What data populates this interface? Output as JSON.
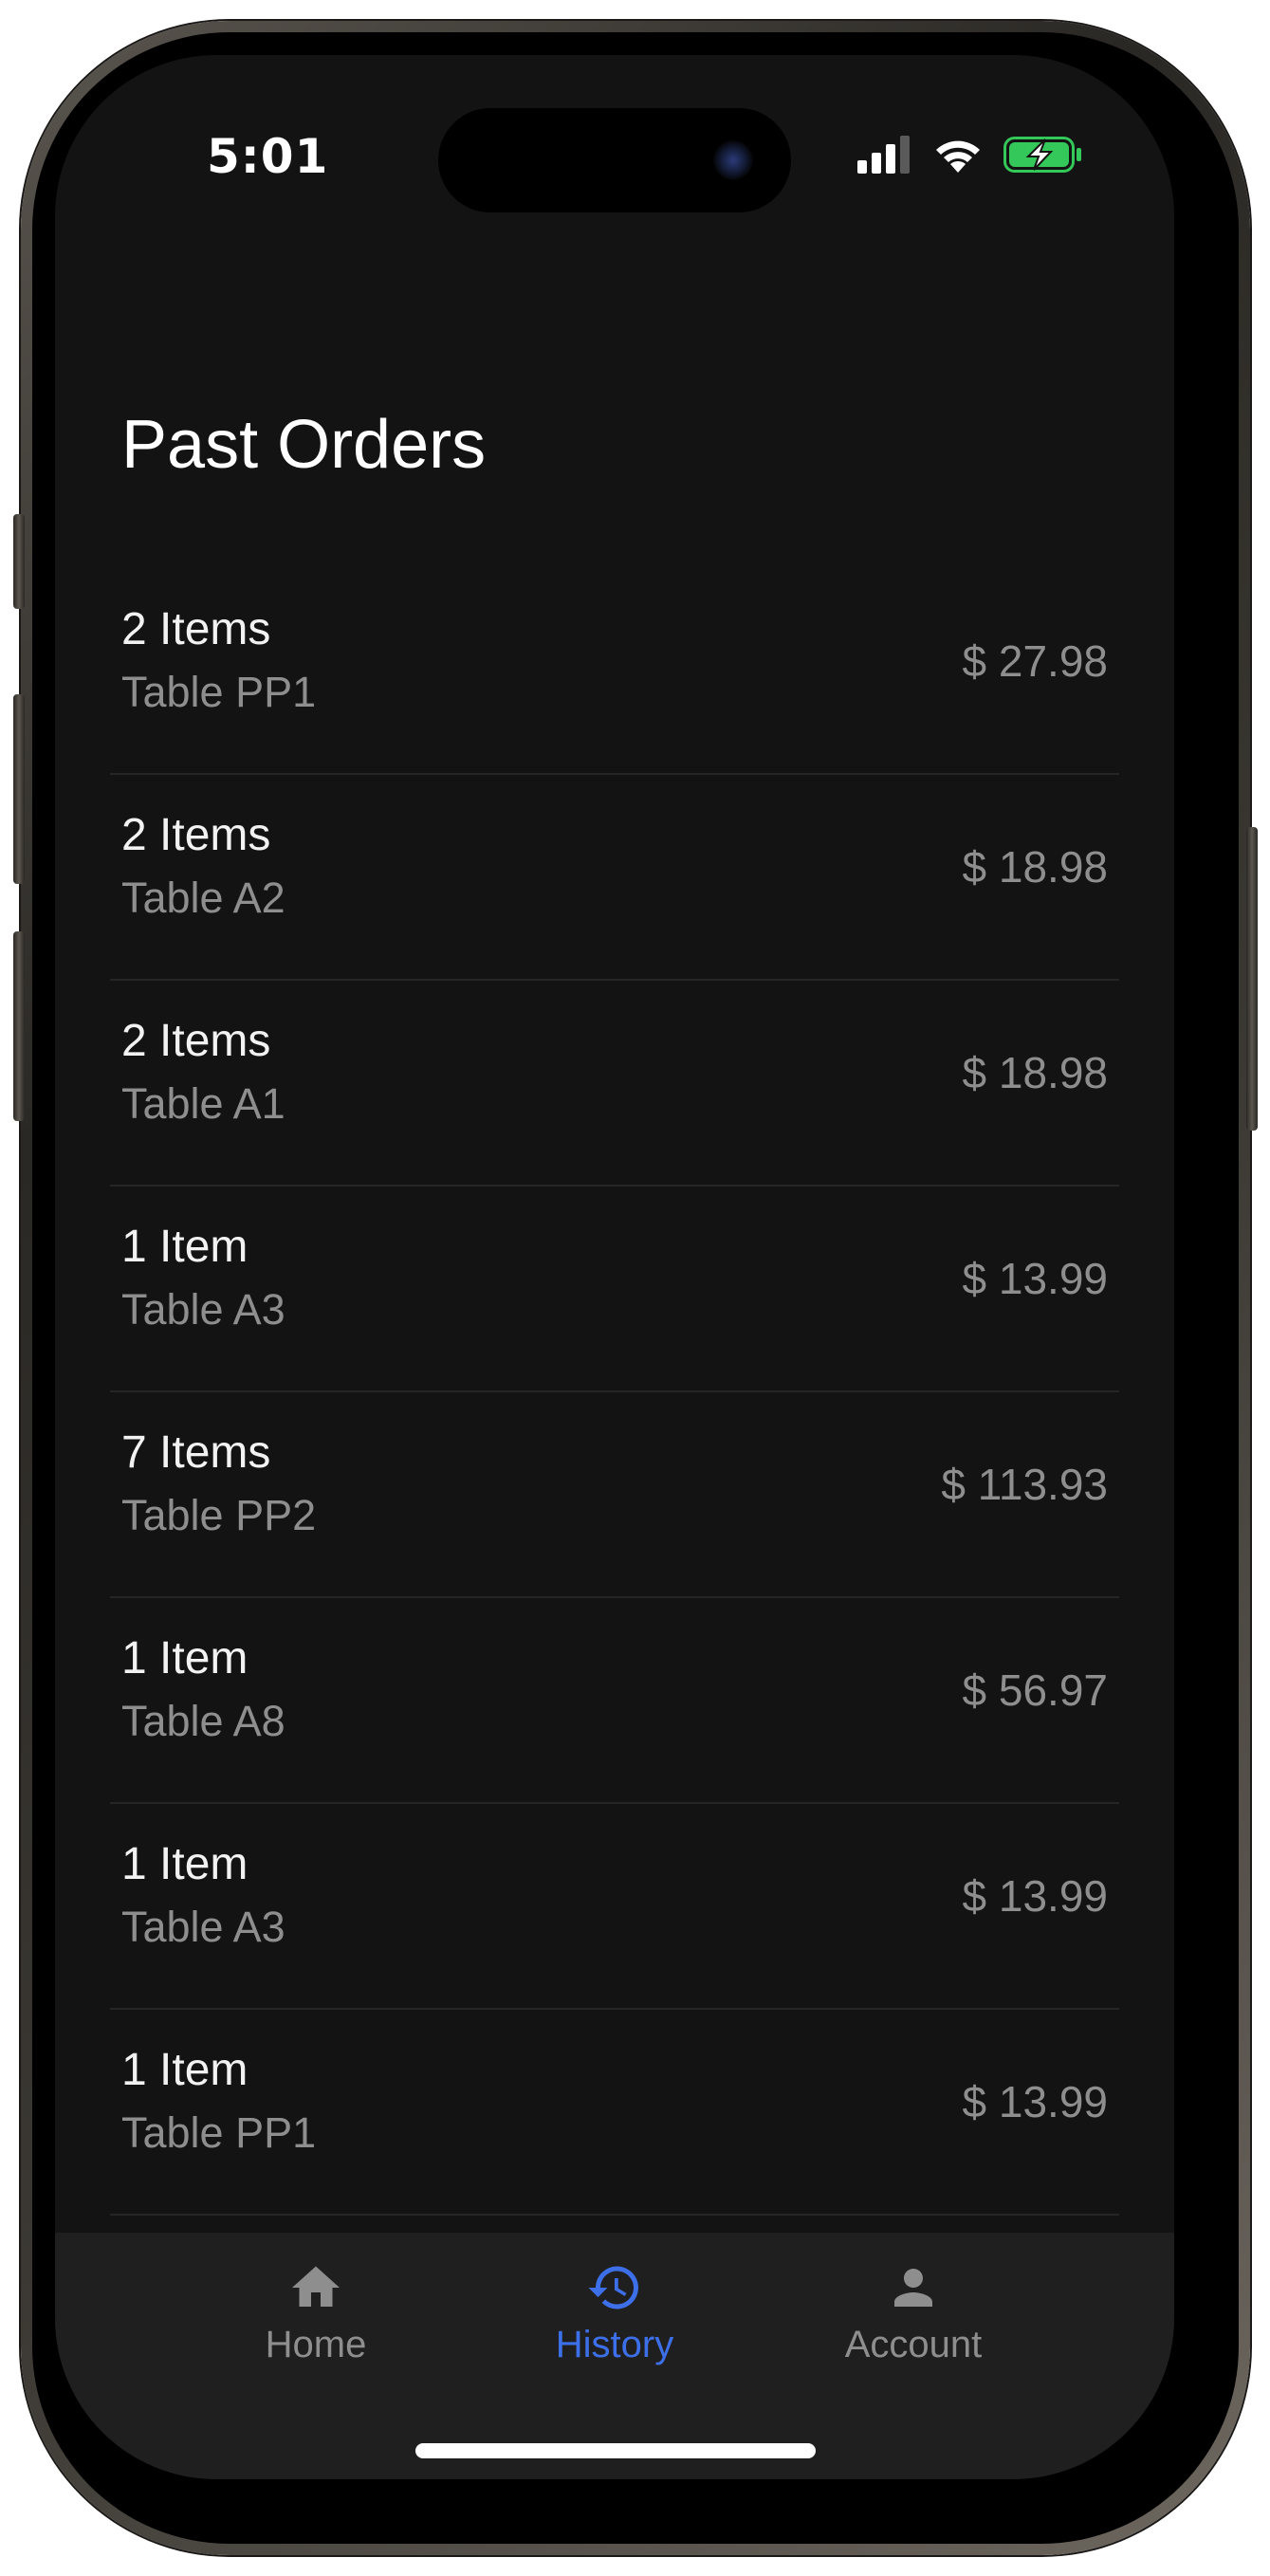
{
  "status_bar": {
    "time": "5:01",
    "icons": [
      "cellular-signal-icon",
      "wifi-icon",
      "battery-charging-icon"
    ],
    "battery_color": "#34c759"
  },
  "page": {
    "title": "Past Orders"
  },
  "orders": [
    {
      "count": "2 Items",
      "table": "Table PP1",
      "price": "$ 27.98"
    },
    {
      "count": "2 Items",
      "table": "Table A2",
      "price": "$ 18.98"
    },
    {
      "count": "2 Items",
      "table": "Table A1",
      "price": "$ 18.98"
    },
    {
      "count": "1 Item",
      "table": "Table A3",
      "price": "$ 13.99"
    },
    {
      "count": "7 Items",
      "table": "Table PP2",
      "price": "$ 113.93"
    },
    {
      "count": "1 Item",
      "table": "Table A8",
      "price": "$ 56.97"
    },
    {
      "count": "1 Item",
      "table": "Table A3",
      "price": "$ 13.99"
    },
    {
      "count": "1 Item",
      "table": "Table PP1",
      "price": "$ 13.99"
    }
  ],
  "tabbar": {
    "tabs": [
      {
        "label": "Home",
        "icon": "home-icon",
        "active": false
      },
      {
        "label": "History",
        "icon": "history-icon",
        "active": true
      },
      {
        "label": "Account",
        "icon": "account-icon",
        "active": false
      }
    ],
    "active_color": "#3d6fe8",
    "inactive_color": "#8e8e8e"
  }
}
